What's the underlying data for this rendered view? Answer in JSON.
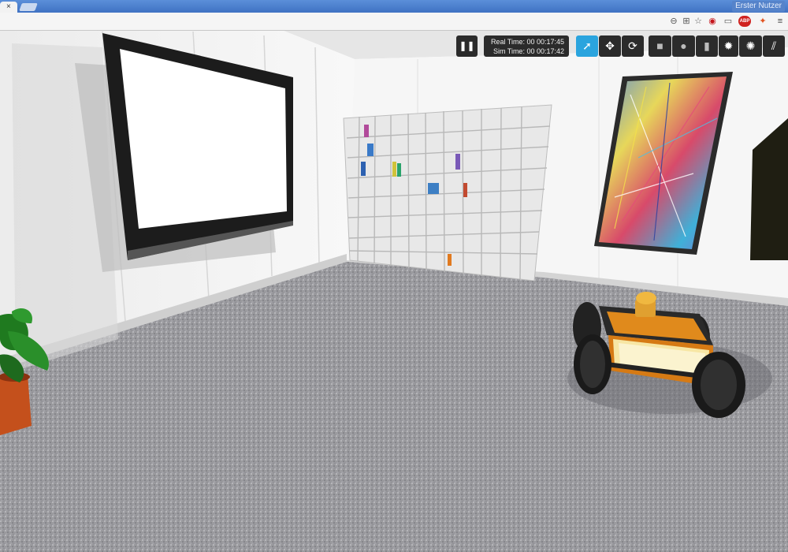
{
  "browser": {
    "tab_close": "×",
    "profile_label": "Erster Nutzer",
    "toolbar_icons": [
      "zoom-icon",
      "translate-icon",
      "bookmark-star-icon",
      "adblock-icon",
      "cast-icon",
      "abp-icon",
      "extension-icon",
      "menu-icon"
    ],
    "abp_label": "ABP",
    "menu_glyph": "≡"
  },
  "gazebo": {
    "pause_glyph": "❚❚",
    "real_time": "Real Time: 00 00:17:45",
    "sim_time": "Sim Time: 00 00:17:42",
    "tools": [
      {
        "name": "select-tool",
        "glyph": "➚",
        "active": true
      },
      {
        "name": "translate-tool",
        "glyph": "✥",
        "active": false
      },
      {
        "name": "rotate-tool",
        "glyph": "⟳",
        "active": false
      }
    ],
    "shapes": [
      {
        "name": "box-shape",
        "glyph": "■"
      },
      {
        "name": "sphere-shape",
        "glyph": "●"
      },
      {
        "name": "cylinder-shape",
        "glyph": "▮"
      },
      {
        "name": "point-light",
        "glyph": "✹"
      },
      {
        "name": "spot-light",
        "glyph": "✺"
      },
      {
        "name": "directional-light",
        "glyph": "⫽"
      }
    ],
    "accent_color": "#2aa4de"
  }
}
